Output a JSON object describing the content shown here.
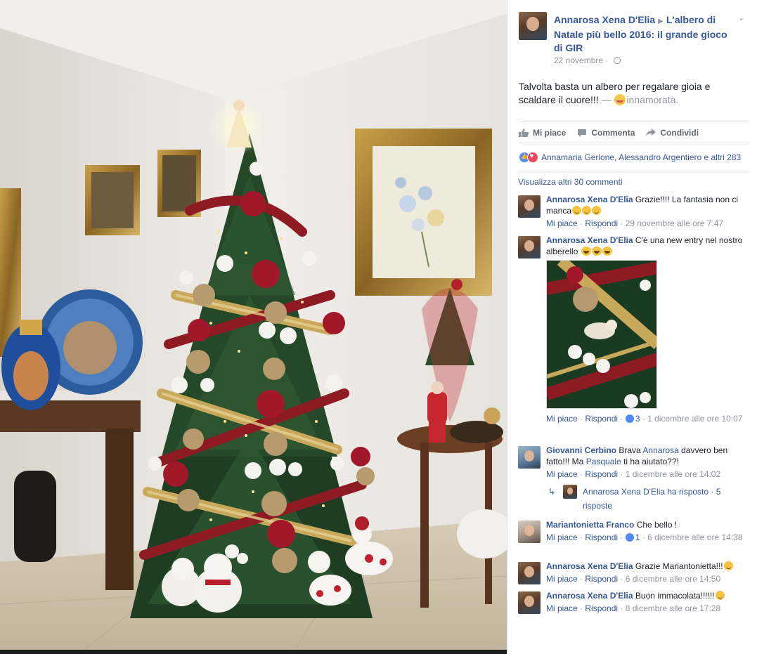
{
  "post": {
    "author": "Annarosa Xena D'Elia",
    "group": "L'albero di Natale più bello 2016: il grande gioco di GIR",
    "date": "22 novembre",
    "caption": "Talvolta basta un albero per regalare gioia e scaldare il cuore!!!",
    "feeling_sep": " — ",
    "feeling": "innamorata."
  },
  "actions": {
    "like": "Mi piace",
    "comment": "Commenta",
    "share": "Condividi"
  },
  "reactions": {
    "text": "Annamaria Gerlone, Alessandro Argentiero e altri 283"
  },
  "comments_header": {
    "more": "Visualizza altri 30 commenti"
  },
  "comments": [
    {
      "author": "Annarosa Xena D'Elia",
      "text": "Grazie!!!! La fantasia non ci manca",
      "like": "Mi piace",
      "reply": "Rispondi",
      "time": "29 novembre alle ore 7:47"
    },
    {
      "author": "Annarosa Xena D'Elia",
      "text": "C'è una new entry nel nostro alberello",
      "like": "Mi piace",
      "reply": "Rispondi",
      "reactions_count": "3",
      "time": "1 dicembre alle ore 10:07"
    },
    {
      "author": "Giovanni Cerbino",
      "text_a": "Brava",
      "mention_a": "Annarosa",
      "text_b": "davvero ben fatto!!! Ma",
      "mention_b": "Pasquale",
      "text_c": "ti ha aiutato??!",
      "like": "Mi piace",
      "reply": "Rispondi",
      "time": "1 dicembre alle ore 14:02",
      "replies": "Annarosa Xena D'Elia ha risposto · 5 risposte"
    },
    {
      "author": "Mariantonietta Franco",
      "text": "Che bello !",
      "like": "Mi piace",
      "reply": "Rispondi",
      "reactions_count": "1",
      "time": "6 dicembre alle ore 14:38"
    },
    {
      "author": "Annarosa Xena D'Elia",
      "text": "Grazie Mariantonietta!!!",
      "like": "Mi piace",
      "reply": "Rispondi",
      "time": "6 dicembre alle ore 14:50"
    },
    {
      "author": "Annarosa Xena D'Elia",
      "text": "Buon immacolata!!!!!!",
      "like": "Mi piace",
      "reply": "Rispondi",
      "time": "8 dicembre alle ore 17:28"
    }
  ],
  "colors": {
    "link": "#365899",
    "meta": "#90949c",
    "text": "#1d2129",
    "ribbon_red": "#8e1b24",
    "tree_green": "#1f3d22"
  }
}
